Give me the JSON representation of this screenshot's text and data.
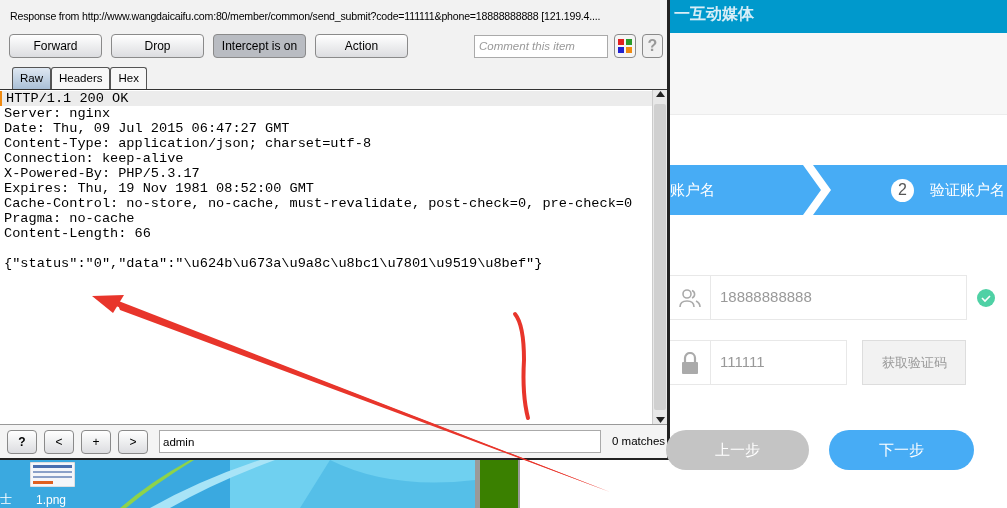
{
  "burp": {
    "title": "Response from http://www.wangdaicaifu.com:80/member/common/send_submit?code=111111&phone=18888888888  [121.199.4....",
    "buttons": [
      {
        "label": "Forward",
        "pressed": false
      },
      {
        "label": "Drop",
        "pressed": false
      },
      {
        "label": "Intercept is on",
        "pressed": true
      },
      {
        "label": "Action",
        "pressed": false
      }
    ],
    "comment": {
      "placeholder": "Comment this item"
    },
    "help": "?",
    "tabs": [
      {
        "label": "Raw",
        "selected": true
      },
      {
        "label": "Headers",
        "selected": false
      },
      {
        "label": "Hex",
        "selected": false
      }
    ],
    "lines": [
      {
        "text": "HTTP/1.1 200 OK",
        "selected": true
      },
      {
        "text": "Server: nginx",
        "selected": false
      },
      {
        "text": "Date: Thu, 09 Jul 2015 06:47:27 GMT",
        "selected": false
      },
      {
        "text": "Content-Type: application/json; charset=utf-8",
        "selected": false
      },
      {
        "text": "Connection: keep-alive",
        "selected": false
      },
      {
        "text": "X-Powered-By: PHP/5.3.17",
        "selected": false
      },
      {
        "text": "Expires: Thu, 19 Nov 1981 08:52:00 GMT",
        "selected": false
      },
      {
        "text": "Cache-Control: no-store, no-cache, must-revalidate, post-check=0, pre-check=0",
        "selected": false
      },
      {
        "text": "Pragma: no-cache",
        "selected": false
      },
      {
        "text": "Content-Length: 66",
        "selected": false
      },
      {
        "text": "{\"status\":\"0\",\"data\":\"\\u624b\\u673a\\u9a8c\\u8bc1\\u7801\\u9519\\u8bef\"}",
        "selected": false
      }
    ],
    "search": {
      "buttons": [
        "?",
        "<",
        "+",
        ">"
      ],
      "value": "admin",
      "matches": "0 matches"
    }
  },
  "desktop": {
    "edge_char": "士",
    "icon_label": "1.png"
  },
  "page": {
    "header_title": "一互动媒体",
    "steps": [
      {
        "label": "账户名"
      },
      {
        "number": "2",
        "label": "验证账户名"
      }
    ],
    "phone": {
      "value": "18888888888",
      "valid": true
    },
    "code": {
      "value": "111111"
    },
    "code_button": "获取验证码",
    "prev_button": {
      "label": "上一步",
      "disabled": true
    },
    "next_button": {
      "label": "下一步",
      "disabled": false
    }
  }
}
